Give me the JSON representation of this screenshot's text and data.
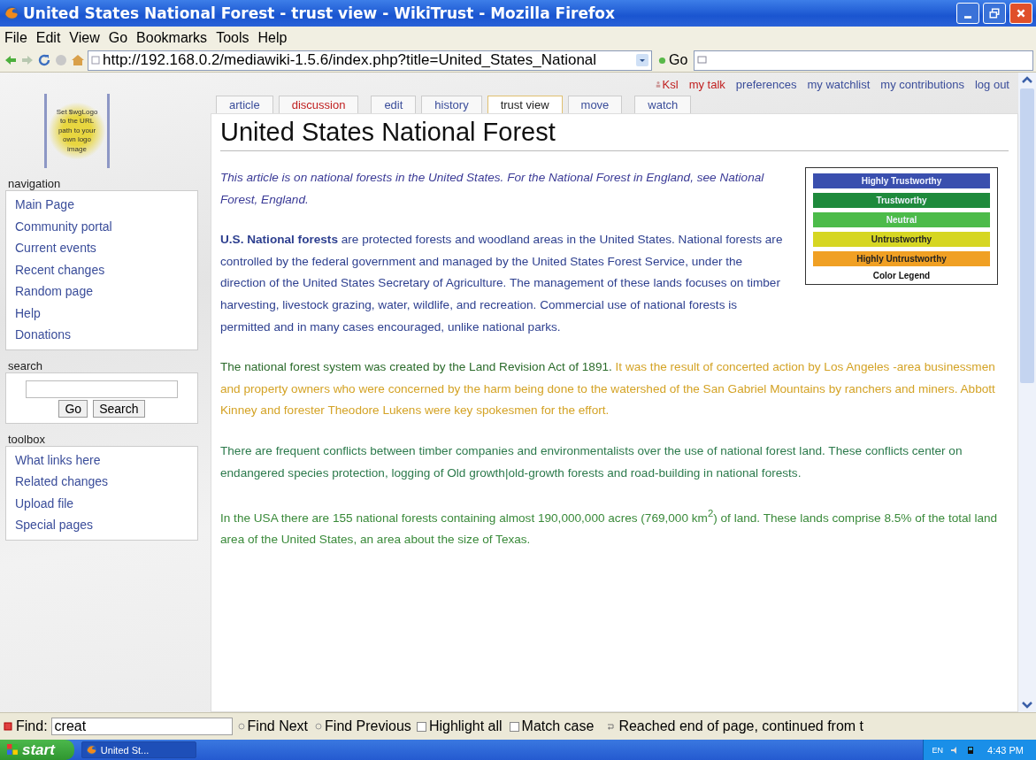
{
  "window": {
    "title": "United States National Forest - trust view - WikiTrust - Mozilla Firefox"
  },
  "menu": [
    "File",
    "Edit",
    "View",
    "Go",
    "Bookmarks",
    "Tools",
    "Help"
  ],
  "address": {
    "url": "http://192.168.0.2/mediawiki-1.5.6/index.php?title=United_States_National",
    "go": "Go"
  },
  "personal": [
    {
      "label": "Ksl",
      "new": true
    },
    {
      "label": "my talk",
      "new": true
    },
    {
      "label": "preferences",
      "new": false
    },
    {
      "label": "my watchlist",
      "new": false
    },
    {
      "label": "my contributions",
      "new": false
    },
    {
      "label": "log out",
      "new": false
    }
  ],
  "tab_groups": [
    [
      {
        "label": "article",
        "selected": false,
        "new": false
      },
      {
        "label": "discussion",
        "selected": false,
        "new": true
      }
    ],
    [
      {
        "label": "edit",
        "selected": false,
        "new": false
      },
      {
        "label": "history",
        "selected": false,
        "new": false
      },
      {
        "label": "trust view",
        "selected": true,
        "new": false
      },
      {
        "label": "move",
        "selected": false,
        "new": false
      }
    ],
    [
      {
        "label": "watch",
        "selected": false,
        "new": false
      }
    ]
  ],
  "logo": {
    "lines": [
      "Set $wgLogo",
      "to the URL",
      "path to your",
      "own logo",
      "image"
    ]
  },
  "navigation": {
    "heading": "navigation",
    "items": [
      "Main Page",
      "Community portal",
      "Current events",
      "Recent changes",
      "Random page",
      "Help",
      "Donations"
    ]
  },
  "search": {
    "heading": "search",
    "buttons": [
      "Go",
      "Search"
    ]
  },
  "toolbox": {
    "heading": "toolbox",
    "items": [
      "What links here",
      "Related changes",
      "Upload file",
      "Special pages"
    ]
  },
  "article": {
    "title": "United States National Forest",
    "paragraphs": [
      {
        "kind": "hatnote",
        "segments": [
          {
            "text": "This article is on national forests in the United States. For the National Forest in England, see National Forest, England.",
            "color": "#3a3a96"
          }
        ]
      },
      {
        "kind": "body",
        "segments": [
          {
            "text": "**U.S. National forests** are protected forests and woodland areas in the United States. National forests are controlled by the federal government and managed by the United States Forest Service, under the direction of the United States Secretary of Agriculture. The management of these lands focuses on timber harvesting, livestock grazing, water, wildlife, and recreation. Commercial use of national forests is permitted and in many cases encouraged, unlike national parks.",
            "color": "#2d3f8f"
          }
        ]
      },
      {
        "kind": "body",
        "segments": [
          {
            "text": "The national forest system was created by the Land Revision Act of 1891.",
            "color": "#2b6b2b"
          },
          {
            "text": " It was the result of concerted action by Los Angeles -area businessmen and property owners who were concerned by the harm being done to the watershed of the San Gabriel Mountains by ranchers and miners. Abbott Kinney and forester Theodore Lukens were key spokesmen for the effort.",
            "color": "#d4a326"
          }
        ]
      },
      {
        "kind": "body",
        "segments": [
          {
            "text": "There are frequent conflicts between timber companies and environmentalists over the use of national forest land. These conflicts center on endangered species protection, logging of Old growth|old-growth forests and road-building in national forests.",
            "color": "#2c7a4c"
          }
        ]
      },
      {
        "kind": "body",
        "segments": [
          {
            "text": "In the USA there are 155 national forests containing almost 190,000,000 acres (769,000 km$^{2}$) of land. These lands comprise 8.5% of the total land area of the United States, an area about the size of Texas.",
            "color": "#3a8a3a"
          }
        ]
      }
    ]
  },
  "legend": {
    "items": [
      {
        "label": "Highly Trustworthy",
        "color": "#3a4fae"
      },
      {
        "label": "Trustworthy",
        "color": "#1e8a3c"
      },
      {
        "label": "Neutral",
        "color": "#4cbb4a"
      },
      {
        "label": "Untrustworthy",
        "color": "#d6d622"
      },
      {
        "label": "Highly Untrustworthy",
        "color": "#f0a024"
      }
    ],
    "caption": "Color Legend"
  },
  "find_bar": {
    "label": "Find:",
    "value": "creat",
    "buttons": [
      "Find Next",
      "Find Previous"
    ],
    "checkboxes": [
      {
        "label": "Highlight all",
        "checked": false
      },
      {
        "label": "Match case",
        "checked": false
      }
    ],
    "status": "Reached end of page, continued from t"
  },
  "taskbar": {
    "start": "start",
    "tasks": [
      {
        "label": "United St...",
        "selected": true
      }
    ],
    "language": "EN",
    "time": "4:43 PM"
  }
}
